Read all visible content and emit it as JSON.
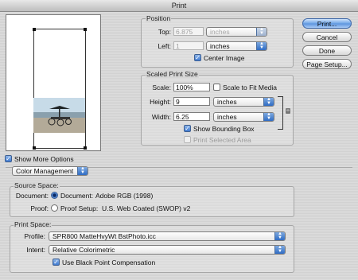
{
  "window": {
    "title": "Print"
  },
  "buttons": {
    "print": "Print...",
    "cancel": "Cancel",
    "done": "Done",
    "page_setup": "Page Setup..."
  },
  "position": {
    "label": "Position",
    "top_label": "Top:",
    "top_value": "6.875",
    "top_unit": "inches",
    "left_label": "Left:",
    "left_value": "1",
    "left_unit": "inches",
    "center_image": "Center Image",
    "center_image_checked": true
  },
  "scaled": {
    "label": "Scaled Print Size",
    "scale_label": "Scale:",
    "scale_value": "100%",
    "scale_to_fit": "Scale to Fit Media",
    "scale_to_fit_checked": false,
    "height_label": "Height:",
    "height_value": "9",
    "height_unit": "inches",
    "width_label": "Width:",
    "width_value": "6.25",
    "width_unit": "inches",
    "show_bounding_box": "Show Bounding Box",
    "show_bounding_box_checked": true,
    "print_selected_area": "Print Selected Area",
    "print_selected_area_checked": false
  },
  "more_options": {
    "label": "Show More Options",
    "checked": true
  },
  "color_mode": {
    "value": "Color Management"
  },
  "source_space": {
    "label": "Source Space:",
    "document_label": "Document:",
    "document_option": "Document:",
    "document_value": "Adobe RGB (1998)",
    "proof_label": "Proof:",
    "proof_option": "Proof Setup:",
    "proof_value": "U.S. Web Coated (SWOP) v2",
    "selected": "document"
  },
  "print_space": {
    "label": "Print Space:",
    "profile_label": "Profile:",
    "profile_value": "SPR800 MatteHvyWt BstPhoto.icc",
    "intent_label": "Intent:",
    "intent_value": "Relative Colorimetric",
    "bpc_label": "Use Black Point Compensation",
    "bpc_checked": true
  },
  "icons": {
    "popup_arrow": "updown-arrows-icon",
    "check": "checkmark-icon",
    "link": "chain-link-icon"
  }
}
